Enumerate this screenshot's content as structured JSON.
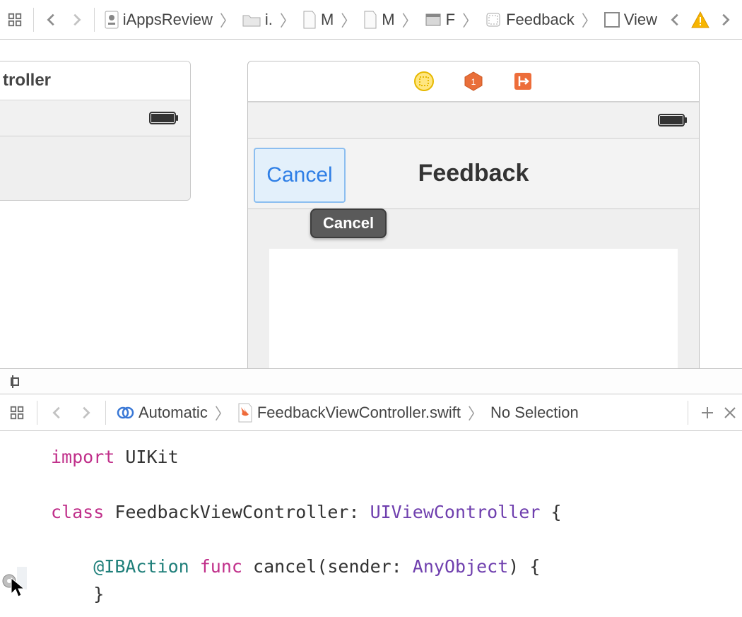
{
  "jumpbar": {
    "crumbs": [
      {
        "label": "iAppsReview",
        "icon": "app"
      },
      {
        "label": "i.",
        "icon": "folder"
      },
      {
        "label": "M",
        "icon": "file"
      },
      {
        "label": "M",
        "icon": "file"
      },
      {
        "label": "F",
        "icon": "storyboard"
      },
      {
        "label": "Feedback",
        "icon": "scene"
      },
      {
        "label": "View",
        "icon": "view"
      }
    ]
  },
  "scene_left": {
    "title": "troller"
  },
  "nav": {
    "title": "Feedback",
    "cancel_label": "Cancel",
    "tooltip": "Cancel"
  },
  "assist": {
    "mode": "Automatic",
    "file": "FeedbackViewController.swift",
    "selection": "No Selection"
  },
  "code": {
    "l1a": "import",
    "l1b": " UIKit",
    "l3a": "class",
    "l3b": " FeedbackViewController: ",
    "l3c": "UIViewController",
    "l3d": " {",
    "l5a": "@IBAction",
    "l5b": "func",
    "l5c": " cancel(sender: ",
    "l5d": "AnyObject",
    "l5e": ") {",
    "l6": "    }"
  }
}
